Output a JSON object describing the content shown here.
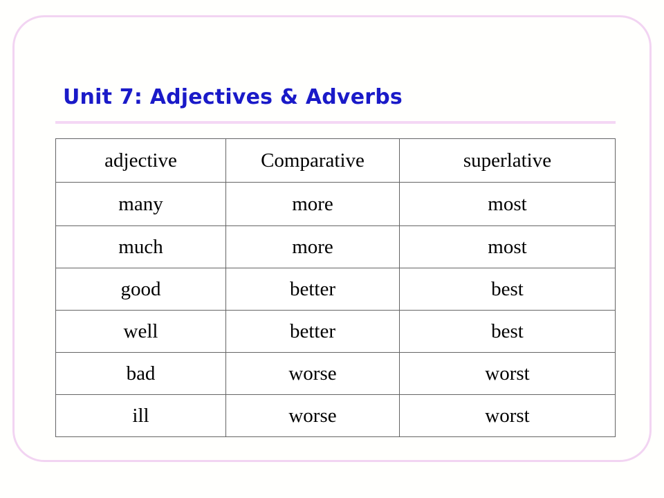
{
  "slide": {
    "title": "Unit 7: Adjectives & Adverbs",
    "accent_color": "#1a1ac8",
    "frame_color": "#f2d4f2",
    "rule_color": "#f4d7f4",
    "table_border_color": "#646464",
    "background_color": "#fffffd"
  },
  "table": {
    "columns": [
      "adjective",
      "Comparative",
      "superlative"
    ],
    "rows": [
      [
        "many",
        "more",
        "most"
      ],
      [
        "much",
        "more",
        "most"
      ],
      [
        "good",
        "better",
        "best"
      ],
      [
        "well",
        "better",
        "best"
      ],
      [
        "bad",
        "worse",
        "worst"
      ],
      [
        "ill",
        "worse",
        "worst"
      ]
    ]
  }
}
